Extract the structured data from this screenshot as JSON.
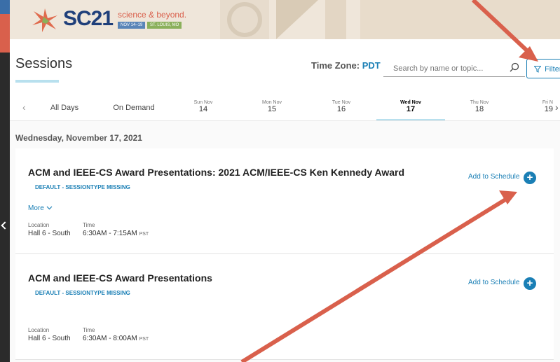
{
  "banner": {
    "logo_text": "SC21",
    "tagline": "science & beyond.",
    "dates": "NOV 14–19",
    "city": "ST. LOUIS, MO"
  },
  "header": {
    "title": "Sessions",
    "timezone_label": "Time Zone:",
    "timezone_value": "PDT",
    "search_placeholder": "Search by name or topic...",
    "filter_label": "Filter"
  },
  "days": {
    "all_days": "All Days",
    "on_demand": "On Demand",
    "tabs": [
      {
        "dow": "Sun Nov",
        "num": "14"
      },
      {
        "dow": "Mon Nov",
        "num": "15"
      },
      {
        "dow": "Tue Nov",
        "num": "16"
      },
      {
        "dow": "Wed Nov",
        "num": "17"
      },
      {
        "dow": "Thu Nov",
        "num": "18"
      },
      {
        "dow": "Fri N",
        "num": "19"
      }
    ]
  },
  "date_heading": "Wednesday, November 17, 2021",
  "sessions": [
    {
      "title": "ACM and IEEE-CS Award Presentations: 2021 ACM/IEEE-CS Ken Kennedy Award",
      "type": "DEFAULT - SESSIONTYPE MISSING",
      "more": "More",
      "location_label": "Location",
      "location": "Hall 6 - South",
      "time_label": "Time",
      "time": "6:30AM - 7:15AM",
      "tz": "PST",
      "add_label": "Add to Schedule"
    },
    {
      "title": "ACM and IEEE-CS Award Presentations",
      "type": "DEFAULT - SESSIONTYPE MISSING",
      "location_label": "Location",
      "location": "Hall 6 - South",
      "time_label": "Time",
      "time": "6:30AM - 8:00AM",
      "tz": "PST",
      "add_label": "Add to Schedule"
    }
  ],
  "colors": {
    "accent": "#1a7fb5",
    "annotation_arrow": "#d9604c"
  }
}
